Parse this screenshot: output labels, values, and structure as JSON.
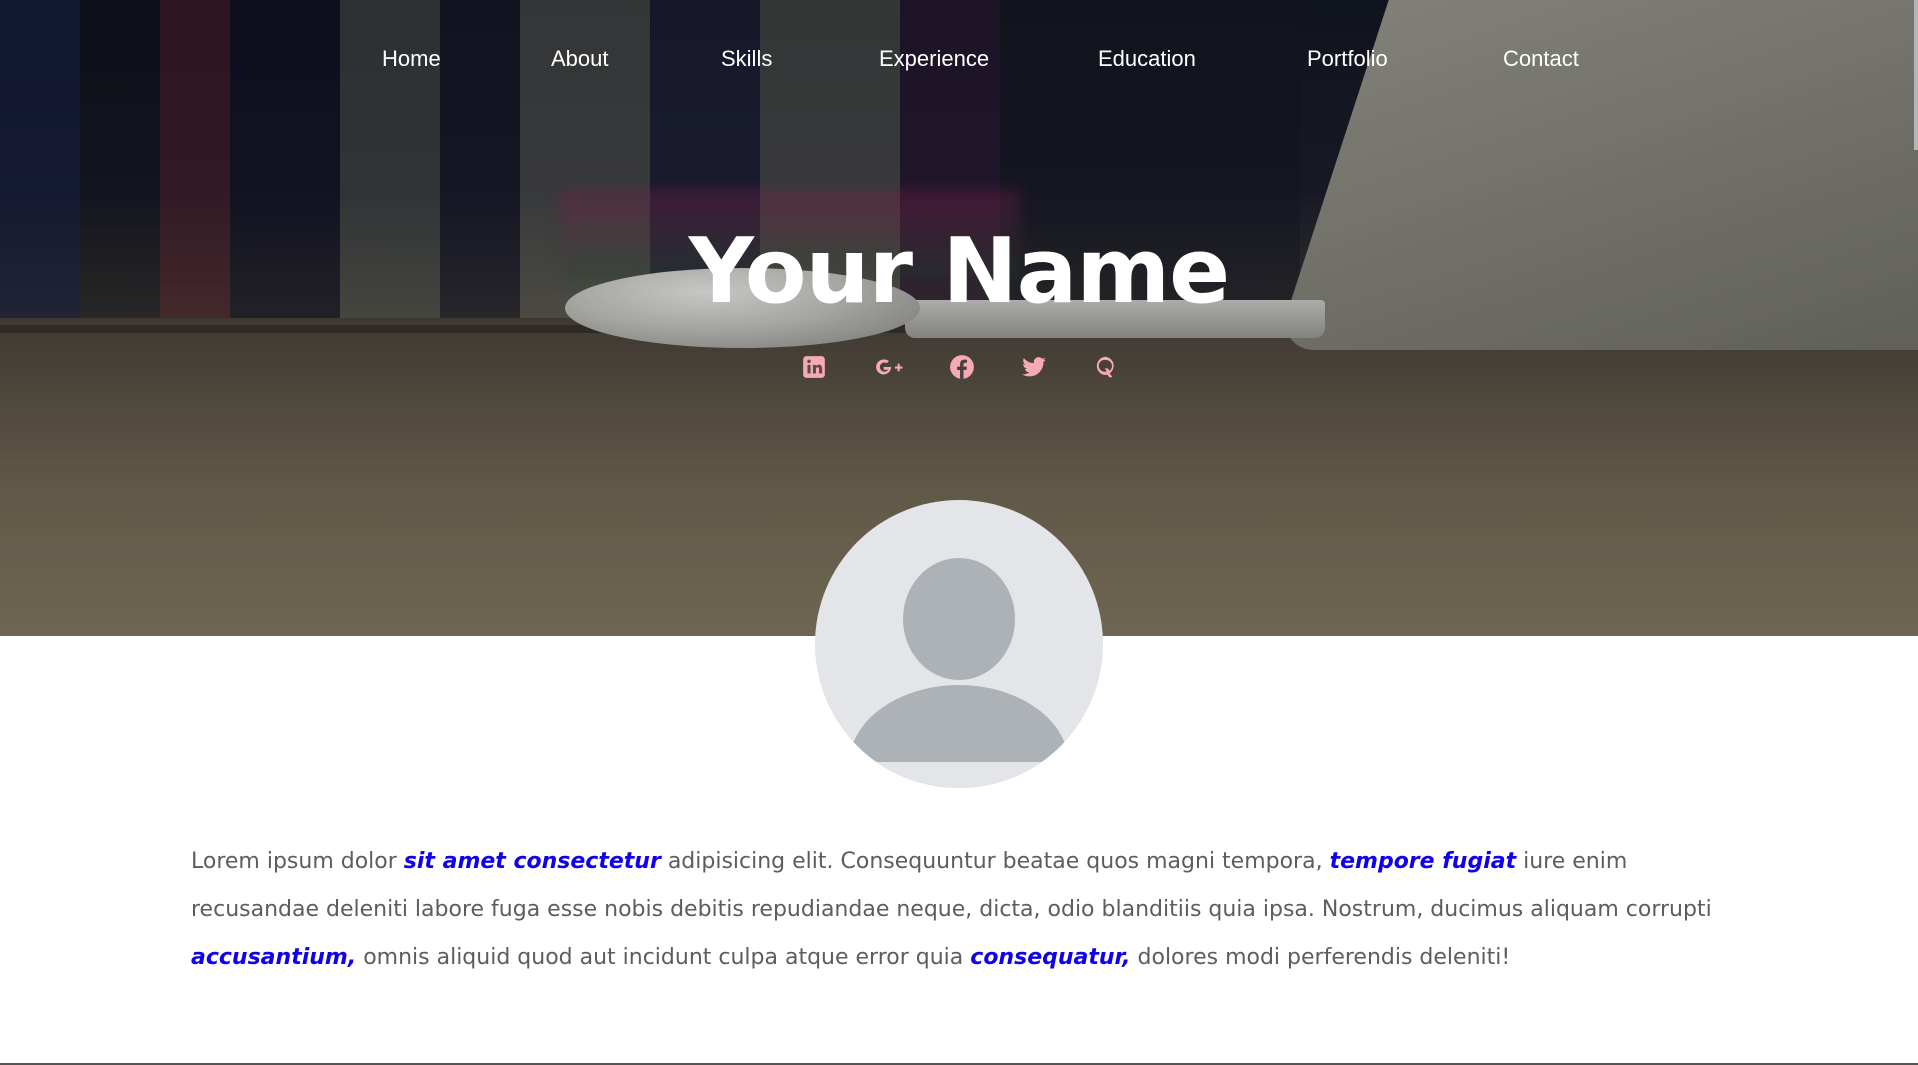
{
  "nav": {
    "items": [
      {
        "label": "Home"
      },
      {
        "label": "About"
      },
      {
        "label": "Skills"
      },
      {
        "label": "Experience"
      },
      {
        "label": "Education"
      },
      {
        "label": "Portfolio"
      },
      {
        "label": "Contact"
      }
    ]
  },
  "hero": {
    "title": "Your Name",
    "socials": [
      {
        "icon": "linkedin-icon"
      },
      {
        "icon": "google-plus-icon"
      },
      {
        "icon": "facebook-icon"
      },
      {
        "icon": "twitter-icon"
      },
      {
        "icon": "quora-icon"
      }
    ],
    "social_color": "#f5aab4"
  },
  "about": {
    "parts": [
      "Lorem ipsum dolor ",
      "sit amet consectetur",
      " adipisicing elit. Consequuntur beatae quos magni tempora, ",
      "tempore fugiat",
      " iure enim recusandae deleniti labore fuga esse nobis debitis repudiandae neque, dicta, odio blanditiis quia ipsa. Nostrum, ducimus aliquam corrupti ",
      "accusantium,",
      " omnis aliquid quod aut incidunt culpa atque error quia ",
      "consequatur,",
      " dolores modi perferendis deleniti!"
    ],
    "link_color": "#1100ee",
    "text_color": "#5d5d5d"
  }
}
